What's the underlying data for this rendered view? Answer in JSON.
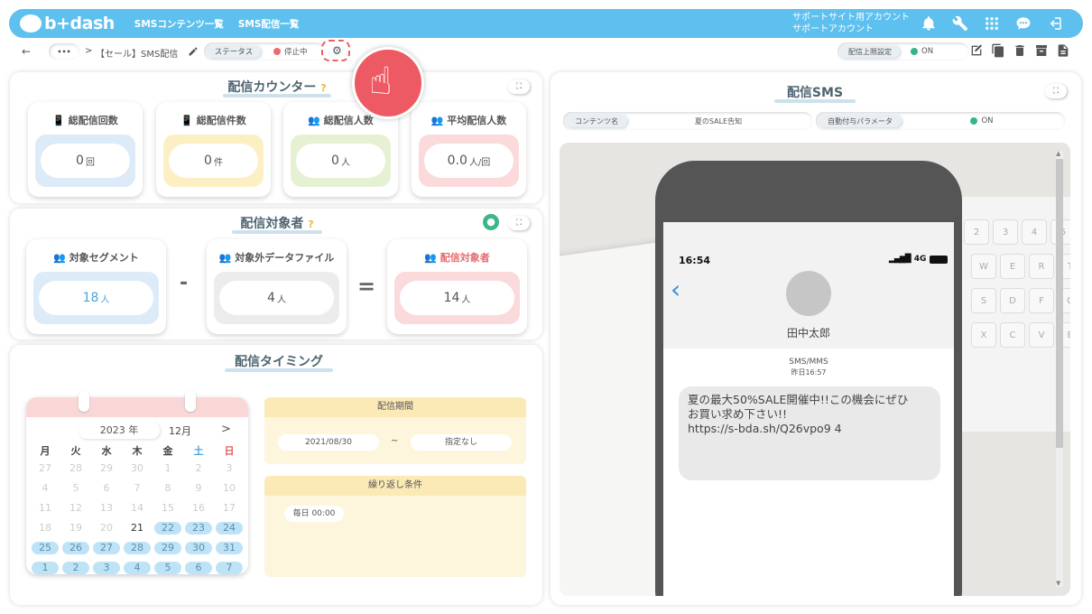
{
  "topbar": {
    "logo_text": "b+dash",
    "nav": [
      "SMSコンテンツ一覧",
      "SMS配信一覧"
    ],
    "support_line1": "サポートサイト用アカウント",
    "support_line2": "サポートアカウント",
    "icons": [
      "bell-icon",
      "wrench-icon",
      "grid-icon",
      "chat-icon",
      "logout-icon"
    ]
  },
  "breadcrumb": {
    "back": "←",
    "more": "•••",
    "sep": ">",
    "title": "【セール】SMS配信",
    "status_label": "ステータス",
    "status_value": "停止中",
    "limit_label": "配信上限設定",
    "limit_value": "ON"
  },
  "counter": {
    "title": "配信カウンター",
    "cards": [
      {
        "label": "総配信回数",
        "value": "0",
        "unit": "回",
        "color": "#dcebf7"
      },
      {
        "label": "総配信件数",
        "value": "0",
        "unit": "件",
        "color": "#fbefc3"
      },
      {
        "label": "総配信人数",
        "value": "0",
        "unit": "人",
        "color": "#e6f1d4"
      },
      {
        "label": "平均配信人数",
        "value": "0.0",
        "unit": "人/回",
        "color": "#fadadb"
      }
    ]
  },
  "targets": {
    "title": "配信対象者",
    "segment_label": "対象セグメント",
    "segment_value": "18",
    "segment_unit": "人",
    "minus": "-",
    "excluded_label": "対象外データファイル",
    "excluded_value": "4",
    "excluded_unit": "人",
    "equals": "=",
    "result_label": "配信対象者",
    "result_value": "14",
    "result_unit": "人"
  },
  "timing": {
    "title": "配信タイミング",
    "calendar": {
      "year": "2023 年",
      "month": "12月",
      "next": ">",
      "weekdays": [
        "月",
        "火",
        "水",
        "木",
        "金",
        "土",
        "日"
      ],
      "rows": [
        [
          "27",
          "28",
          "29",
          "30",
          "1",
          "2",
          "3"
        ],
        [
          "4",
          "5",
          "6",
          "7",
          "8",
          "9",
          "10"
        ],
        [
          "11",
          "12",
          "13",
          "14",
          "15",
          "16",
          "17"
        ],
        [
          "18",
          "19",
          "20",
          "21",
          "22",
          "23",
          "24"
        ],
        [
          "25",
          "26",
          "27",
          "28",
          "29",
          "30",
          "31"
        ],
        [
          "1",
          "2",
          "3",
          "4",
          "5",
          "6",
          "7"
        ]
      ]
    },
    "period_label": "配信期間",
    "period_start": "2021/08/30",
    "period_sep": "~",
    "period_end": "指定なし",
    "repeat_label": "繰り返し条件",
    "repeat_value": "毎日 00:00"
  },
  "sms": {
    "title": "配信SMS",
    "content_label": "コンテンツ名",
    "content_value": "夏のSALE告知",
    "param_label": "自動付与パラメータ",
    "param_value": "ON",
    "phone": {
      "time": "16:54",
      "network": "4G",
      "contact": "田中太郎",
      "msg_type": "SMS/MMS",
      "msg_time": "昨日16:57",
      "message_line1": "夏の最大50%SALE開催中!!この機会にぜひ",
      "message_line2": "お買い求め下さい!!",
      "message_line3": "https://s-bda.sh/Q26vpo9 4",
      "keys": [
        "2",
        "3",
        "4",
        "5",
        "6",
        "W",
        "E",
        "R",
        "T",
        "S",
        "D",
        "F",
        "G",
        "X",
        "C",
        "V",
        "B"
      ]
    }
  }
}
